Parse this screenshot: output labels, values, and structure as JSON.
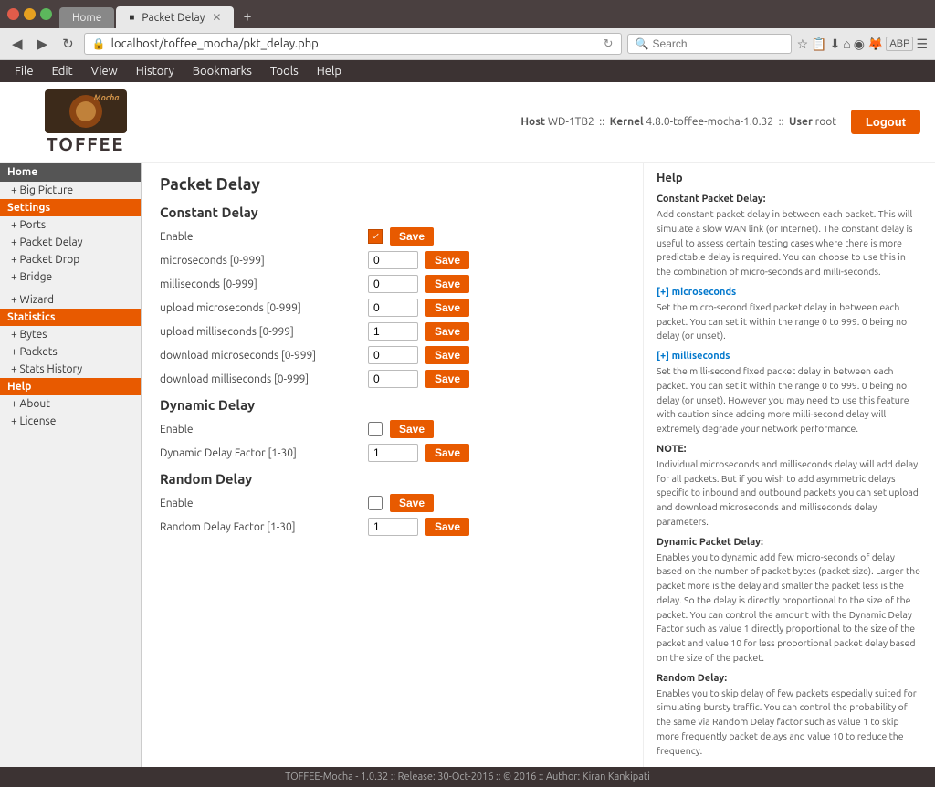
{
  "browser": {
    "tabs": [
      {
        "label": "Home",
        "active": false,
        "has_close": false
      },
      {
        "label": "Packet Delay",
        "active": true,
        "has_close": true
      }
    ],
    "new_tab_icon": "+",
    "url": "localhost/toffee_mocha/pkt_delay.php",
    "search_placeholder": "Search",
    "nav_back": "◀",
    "nav_forward": "▶",
    "nav_refresh": "↻",
    "nav_home": "⌂"
  },
  "menubar": {
    "items": [
      "File",
      "Edit",
      "View",
      "History",
      "Bookmarks",
      "Tools",
      "Help"
    ]
  },
  "header": {
    "host_label": "Host",
    "host_value": "WD-1TB2",
    "kernel_label": "Kernel",
    "kernel_value": "4.8.0-toffee-mocha-1.0.32",
    "user_label": "User",
    "user_value": "root",
    "logout_label": "Logout"
  },
  "sidebar": {
    "logo_main": "TOFFEE",
    "logo_sub": "Mocha",
    "nav_items": [
      {
        "label": "Home",
        "type": "active_home"
      },
      {
        "label": "+ Big Picture",
        "type": "link"
      },
      {
        "label": "Settings",
        "type": "section"
      },
      {
        "label": "+ Ports",
        "type": "link"
      },
      {
        "label": "+ Packet Delay",
        "type": "link"
      },
      {
        "label": "+ Packet Drop",
        "type": "link"
      },
      {
        "label": "+ Bridge",
        "type": "link"
      },
      {
        "label": "+ Wizard",
        "type": "link"
      },
      {
        "label": "Statistics",
        "type": "section"
      },
      {
        "label": "+ Bytes",
        "type": "link"
      },
      {
        "label": "+ Packets",
        "type": "link"
      },
      {
        "label": "+ Stats History",
        "type": "link"
      },
      {
        "label": "Help",
        "type": "section"
      },
      {
        "label": "+ About",
        "type": "link"
      },
      {
        "label": "+ License",
        "type": "link"
      }
    ]
  },
  "page": {
    "title": "Packet Delay",
    "constant_delay": {
      "section_title": "Constant Delay",
      "enable_label": "Enable",
      "enable_checked": true,
      "microseconds_label": "microseconds [0-999]",
      "microseconds_value": "0",
      "milliseconds_label": "milliseconds [0-999]",
      "milliseconds_value": "0",
      "upload_microseconds_label": "upload microseconds [0-999]",
      "upload_microseconds_value": "0",
      "upload_milliseconds_label": "upload milliseconds [0-999]",
      "upload_milliseconds_value": "1",
      "download_microseconds_label": "download microseconds [0-999]",
      "download_microseconds_value": "0",
      "download_milliseconds_label": "download milliseconds [0-999]",
      "download_milliseconds_value": "0"
    },
    "dynamic_delay": {
      "section_title": "Dynamic Delay",
      "enable_label": "Enable",
      "enable_checked": false,
      "factor_label": "Dynamic Delay Factor [1-30]",
      "factor_value": "1"
    },
    "random_delay": {
      "section_title": "Random Delay",
      "enable_label": "Enable",
      "enable_checked": false,
      "factor_label": "Random Delay Factor [1-30]",
      "factor_value": "1"
    },
    "save_label": "Save"
  },
  "help": {
    "title": "Help",
    "sections": [
      {
        "title": "Constant Packet Delay:",
        "text": "Add constant packet delay in between each packet. This will simulate a slow WAN link (or Internet). The constant delay is useful to assess certain testing cases where there is more predictable delay is required. You can choose to use this in the combination of micro-seconds and milli-seconds."
      },
      {
        "title": "[+] microseconds",
        "text": "Set the micro-second fixed packet delay in between each packet. You can set it within the range 0 to 999. 0 being no delay (or unset)."
      },
      {
        "title": "[+] milliseconds",
        "text": "Set the milli-second fixed packet delay in between each packet. You can set it within the range 0 to 999. 0 being no delay (or unset). However you may need to use this feature with caution since adding more milli-second delay will extremely degrade your network performance."
      },
      {
        "title": "NOTE:",
        "text": "Individual microseconds and milliseconds delay will add delay for all packets. But if you wish to add asymmetric delays specific to inbound and outbound packets you can set upload and download microseconds and milliseconds delay parameters."
      },
      {
        "title": "Dynamic Packet Delay:",
        "text": "Enables you to dynamic add few micro-seconds of delay based on the number of packet bytes (packet size). Larger the packet more is the delay and smaller the packet less is the delay. So the delay is directly proportional to the size of the packet. You can control the amount with the Dynamic Delay Factor such as value 1 directly proportional to the size of the packet and value 10 for less proportional packet delay based on the size of the packet."
      },
      {
        "title": "Random Delay:",
        "text": "Enables you to skip delay of few packets especially suited for simulating bursty traffic. You can control the probability of the same via Random Delay factor such as value 1 to skip more frequently packet delays and value 10 to reduce the frequency."
      }
    ]
  },
  "footer": {
    "text": "TOFFEE-Mocha - 1.0.32 :: Release: 30-Oct-2016 :: © 2016 :: Author: Kiran Kankipati"
  }
}
